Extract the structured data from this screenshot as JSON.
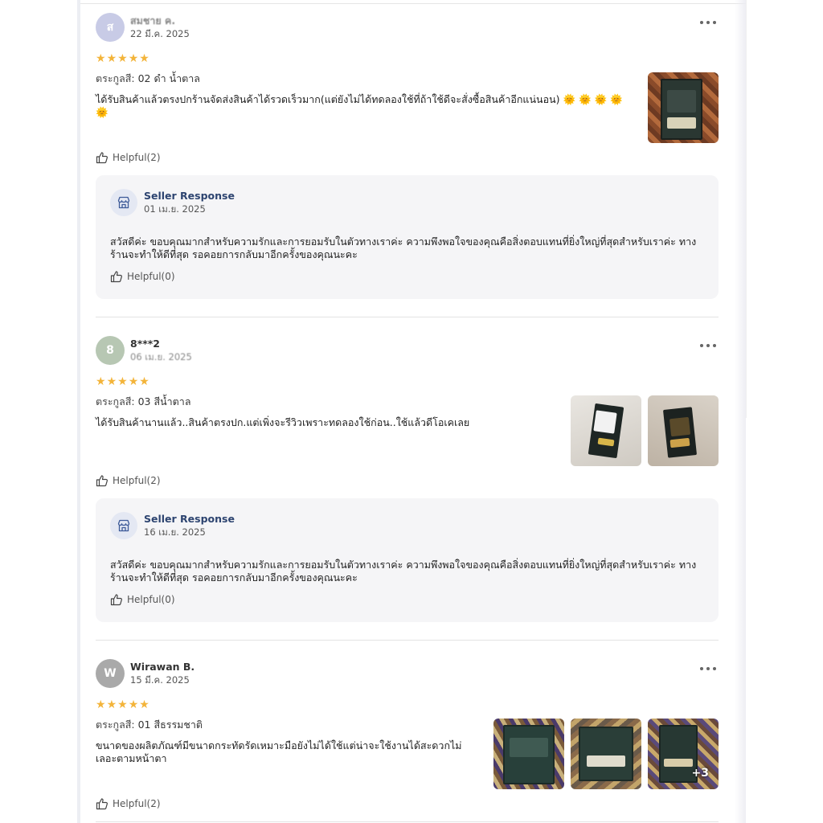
{
  "reviews": [
    {
      "initial": "ส",
      "avatar_color": "#c8cbe6",
      "name": "สมชาย ค.",
      "date": "22 มี.ค. 2025",
      "rating": 5,
      "variant_label": "ตระกูลสี:",
      "variant_value": "02 ดำ น้ำตาล",
      "text": "ได้รับสินค้าแล้วตรงปกร้านจัดส่งสินค้าได้รวดเร็วมาก(แต่ยังไม่ได้ทดลองใช้ที่ถ้าใช้ดีจะสั่งซื้อสินค้าอีกแน่นอน)",
      "emoji": "🌞 🌞 🌞 🌞 🌞",
      "helpful": "Helpful(2)",
      "image_count": 1,
      "seller": {
        "title": "Seller Response",
        "date": "01 เม.ย. 2025",
        "text": "สวัสดีค่ะ ขอบคุณมากสำหรับความรักและการยอมรับในตัวทางเราค่ะ ความพึงพอใจของคุณคือสิ่งตอบแทนที่ยิ่งใหญ่ที่สุดสำหรับเราค่ะ ทางร้านจะทำให้ดีที่สุด รอคอยการกลับมาอีกครั้งของคุณนะคะ",
        "helpful": "Helpful(0)"
      }
    },
    {
      "initial": "8",
      "avatar_color": "#b7c7b3",
      "name": "8***2",
      "date": "06 เม.ย. 2025",
      "rating": 5,
      "variant_label": "ตระกูลสี:",
      "variant_value": "03 สีน้ำตาล",
      "text": "ได้รับสินค้านานแล้ว..สินค้าตรงปก.แต่เพิ่งจะรีวิวเพราะทดลองใช้ก่อน..ใช้แล้วดีโอเคเลย",
      "helpful": "Helpful(2)",
      "image_count": 2,
      "seller": {
        "title": "Seller Response",
        "date": "16 เม.ย. 2025",
        "text": "สวัสดีค่ะ ขอบคุณมากสำหรับความรักและการยอมรับในตัวทางเราค่ะ ความพึงพอใจของคุณคือสิ่งตอบแทนที่ยิ่งใหญ่ที่สุดสำหรับเราค่ะ ทางร้านจะทำให้ดีที่สุด รอคอยการกลับมาอีกครั้งของคุณนะคะ",
        "helpful": "Helpful(0)"
      }
    },
    {
      "initial": "W",
      "avatar_color": "#a9a9a9",
      "name": "Wirawan B.",
      "date": "15 มี.ค. 2025",
      "rating": 5,
      "variant_label": "ตระกูลสี:",
      "variant_value": "01 สีธรรมชาติ",
      "text": "ขนาดของผลิตภัณฑ์มีขนาดกระทัดรัดเหมาะมือยังไม่ได้ใช้แต่น่าจะใช้งานได้สะดวกไม่เลอะตามหน้าตา",
      "helpful": "Helpful(2)",
      "image_count": 3,
      "extra_images": "+3"
    }
  ],
  "colors": {
    "star": "#f3b43a",
    "seller_title": "#2d4470",
    "seller_bg": "#f5f5f7"
  },
  "icons": {
    "more": "more-dots-icon",
    "helpful": "thumbs-up-icon",
    "seller": "store-icon",
    "star": "star-icon"
  }
}
